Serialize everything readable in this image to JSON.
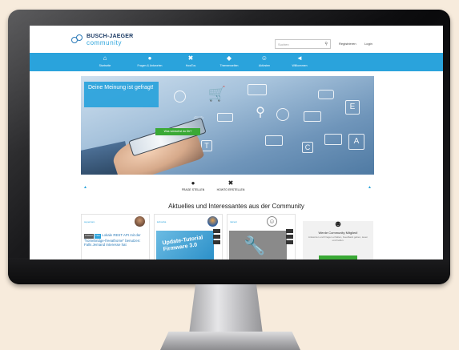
{
  "site": {
    "logo_top": "BUSCH-JAEGER",
    "logo_bottom": "community",
    "search_placeholder": "Suchen",
    "register_label": "Registrieren",
    "login_label": "Login"
  },
  "nav": {
    "items": [
      {
        "label": "Startseite",
        "icon": "home-icon"
      },
      {
        "label": "Fragen & Antworten",
        "icon": "chat-icon"
      },
      {
        "label": "HowTos",
        "icon": "tools-icon"
      },
      {
        "label": "Themenwelten",
        "icon": "tag-icon"
      },
      {
        "label": "Aktivsten",
        "icon": "person-icon"
      },
      {
        "label": "Willkommen",
        "icon": "megaphone-icon"
      }
    ]
  },
  "hero": {
    "bubble_text": "Deine Meinung ist gefragt!",
    "cta_label": "Was wünschst du Dir?"
  },
  "actions": [
    {
      "label": "FRAGE STELLEN",
      "icon": "chat-icon"
    },
    {
      "label": "HOWTO ERSTELLEN",
      "icon": "tools-icon"
    }
  ],
  "section_title": "Aktuelles und Interessantes aus der Community",
  "cards": [
    {
      "head": "supercaro",
      "tag1": "Antwort",
      "tag2": "Neu",
      "text": "Lokale REST API mit der \"homebridge-freeathome\" benutzen: Falls Jemand Interesse hat"
    },
    {
      "head": "kobosha",
      "image_text": "Update-Tutorial Firmware 3.0"
    },
    {
      "head": "ralcent"
    }
  ],
  "promo": {
    "title": "Werde Community Mitglied!",
    "subtitle": "Antworten und Fragen erhalten, Feedback geben, lesen und helfen."
  },
  "colors": {
    "brand_blue": "#2aa3dc",
    "cta_green": "#3aa935",
    "desk_background": "#f7ebdc"
  }
}
